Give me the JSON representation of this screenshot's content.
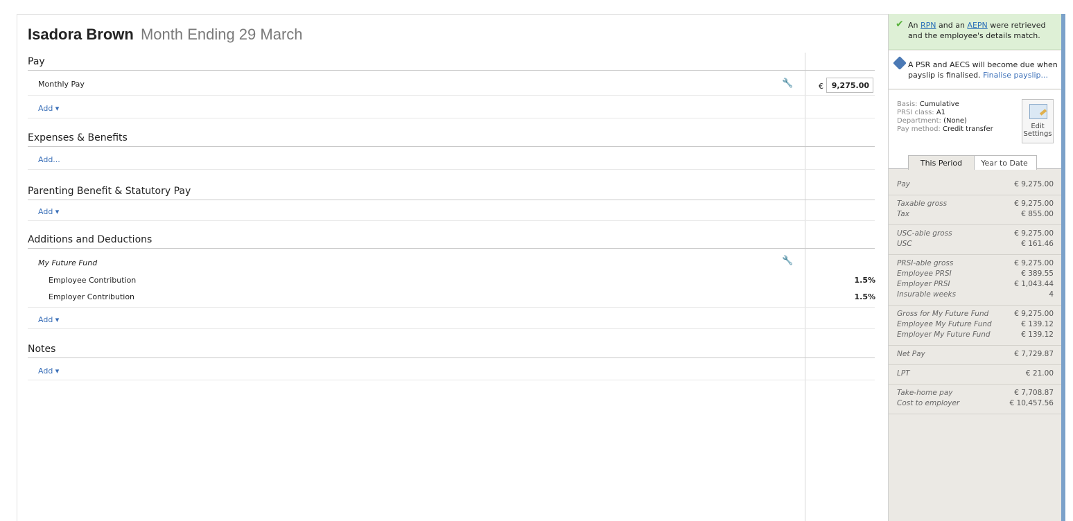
{
  "header": {
    "name": "Isadora Brown",
    "period": "Month Ending 29 March"
  },
  "sections": {
    "pay": {
      "title": "Pay",
      "row_label": "Monthly Pay",
      "currency": "€",
      "amount": "9,275.00",
      "add": "Add ▾"
    },
    "expenses": {
      "title": "Expenses & Benefits",
      "add": "Add..."
    },
    "parenting": {
      "title": "Parenting Benefit & Statutory Pay",
      "add": "Add ▾"
    },
    "additions": {
      "title": "Additions and Deductions",
      "fund": "My Future Fund",
      "employee_label": "Employee Contribution",
      "employee_pct": "1.5%",
      "employer_label": "Employer Contribution",
      "employer_pct": "1.5%",
      "add": "Add ▾"
    },
    "notes": {
      "title": "Notes",
      "add": "Add ▾"
    }
  },
  "sidebar": {
    "notice_ok": {
      "pre": "An ",
      "rpn": "RPN",
      "mid": " and an ",
      "aepn": "AEPN",
      "post": " were retrieved and the employee's details match."
    },
    "notice_info": {
      "text": "A PSR and AECS will become due when payslip is finalised. ",
      "link": "Finalise payslip..."
    },
    "info": {
      "basis_k": "Basis: ",
      "basis_v": "Cumulative",
      "prsi_k": "PRSI class: ",
      "prsi_v": "A1",
      "dept_k": "Department: ",
      "dept_v": "(None)",
      "pay_k": "Pay method: ",
      "pay_v": "Credit transfer",
      "edit_label_1": "Edit",
      "edit_label_2": "Settings"
    },
    "tabs": {
      "this_period": "This Period",
      "ytd": "Year to Date"
    },
    "summary": [
      [
        [
          "Pay",
          "€ 9,275.00"
        ]
      ],
      [
        [
          "Taxable gross",
          "€ 9,275.00"
        ],
        [
          "Tax",
          "€ 855.00"
        ]
      ],
      [
        [
          "USC-able gross",
          "€ 9,275.00"
        ],
        [
          "USC",
          "€ 161.46"
        ]
      ],
      [
        [
          "PRSI-able gross",
          "€ 9,275.00"
        ],
        [
          "Employee PRSI",
          "€ 389.55"
        ],
        [
          "Employer PRSI",
          "€ 1,043.44"
        ],
        [
          "Insurable weeks",
          "4"
        ]
      ],
      [
        [
          "Gross for My Future Fund",
          "€ 9,275.00"
        ],
        [
          "Employee My Future Fund",
          "€ 139.12"
        ],
        [
          "Employer My Future Fund",
          "€ 139.12"
        ]
      ],
      [
        [
          "Net Pay",
          "€ 7,729.87"
        ]
      ],
      [
        [
          "LPT",
          "€ 21.00"
        ]
      ],
      [
        [
          "Take-home pay",
          "€ 7,708.87"
        ],
        [
          "Cost to employer",
          "€ 10,457.56"
        ]
      ]
    ]
  }
}
